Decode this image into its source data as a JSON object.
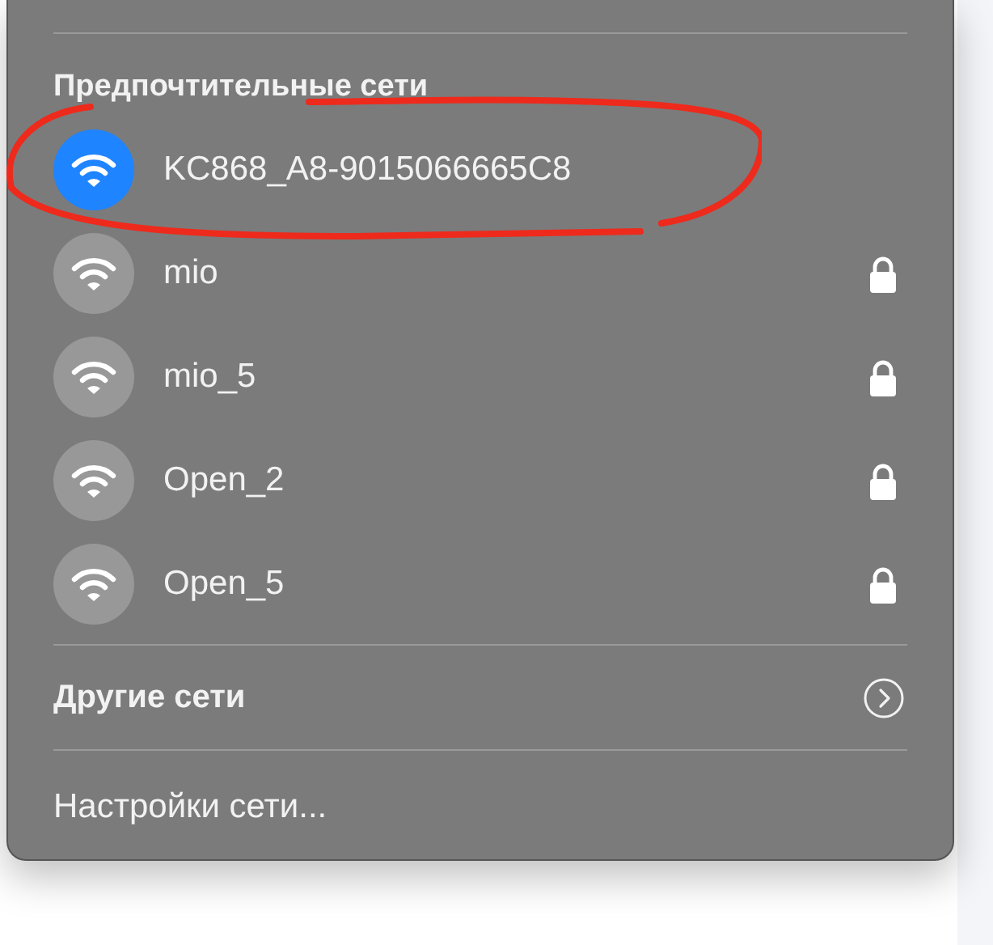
{
  "preferred_networks": {
    "heading": "Предпочтительные сети",
    "items": [
      {
        "name": "KC868_A8-9015066665C8",
        "connected": true,
        "locked": false
      },
      {
        "name": "mio",
        "connected": false,
        "locked": true
      },
      {
        "name": "mio_5",
        "connected": false,
        "locked": true
      },
      {
        "name": "Open_2",
        "connected": false,
        "locked": true
      },
      {
        "name": "Open_5",
        "connected": false,
        "locked": true
      }
    ]
  },
  "other_networks": {
    "label": "Другие сети"
  },
  "network_settings": {
    "label": "Настройки сети..."
  }
}
